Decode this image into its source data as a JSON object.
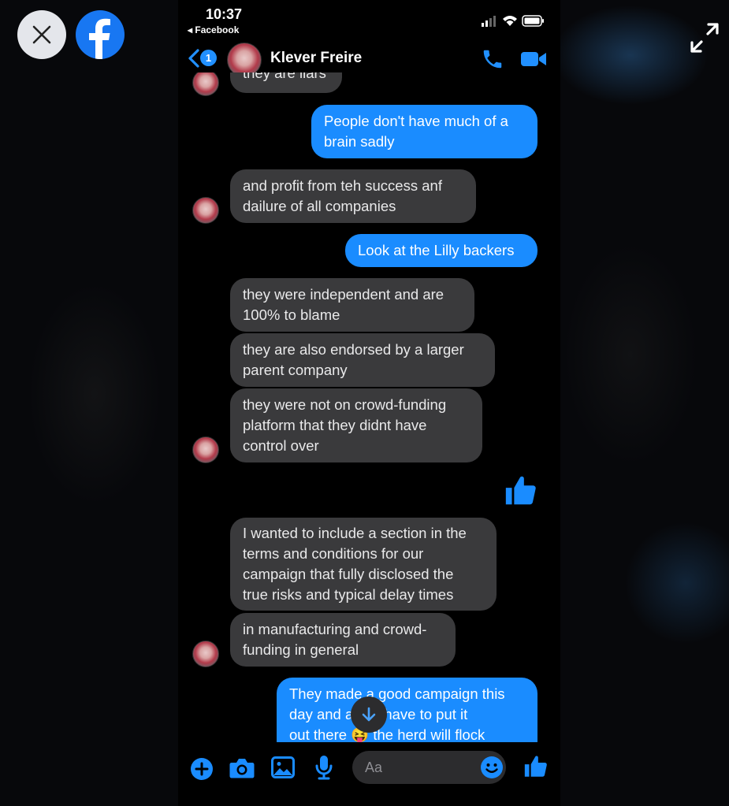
{
  "viewer": {
    "close_icon": "close-icon",
    "brand_icon": "facebook-logo",
    "expand_icon": "expand-arrows-icon"
  },
  "status_bar": {
    "time": "10:37",
    "back_app": "◂ Facebook"
  },
  "header": {
    "unread_count": "1",
    "contact_name": "Klever Freire",
    "accent_color": "#2190ff"
  },
  "messages": [
    {
      "id": "m0",
      "from": "them",
      "lines": [
        "they are liars"
      ]
    },
    {
      "id": "m1",
      "from": "me",
      "lines": [
        "People don't have much of a",
        "brain sadly"
      ]
    },
    {
      "id": "m2",
      "from": "them",
      "lines": [
        "and profit from teh success anf",
        "dailure of all companies"
      ]
    },
    {
      "id": "m3",
      "from": "me",
      "lines": [
        "Look at the Lilly backers"
      ]
    },
    {
      "id": "m4",
      "from": "them",
      "lines": [
        "they were independent and are",
        "100% to blame"
      ]
    },
    {
      "id": "m5",
      "from": "them",
      "lines": [
        "they are also endorsed by a larger",
        "parent company"
      ]
    },
    {
      "id": "m6",
      "from": "them",
      "lines": [
        "they were not on crowd-funding",
        "platform that they didnt have",
        "control over"
      ]
    },
    {
      "id": "m7",
      "from": "me",
      "type": "like"
    },
    {
      "id": "m8",
      "from": "them",
      "lines": [
        "I wanted to include a section in the",
        "terms and conditions for our",
        "campaign that fully disclosed the",
        "true risks and typical delay times"
      ]
    },
    {
      "id": "m9",
      "from": "them",
      "lines": [
        "in manufacturing and crowd-",
        "funding in general"
      ]
    },
    {
      "id": "m10",
      "from": "me",
      "lines": [
        "They made a good campaign this",
        "day and a   just have to put it",
        "out there 😝 the herd will flock"
      ]
    }
  ],
  "composer": {
    "placeholder": "Aa",
    "value": ""
  },
  "colors": {
    "outgoing_bubble": "#1a8cff",
    "incoming_bubble": "#3a3a3c",
    "background": "#000000"
  }
}
